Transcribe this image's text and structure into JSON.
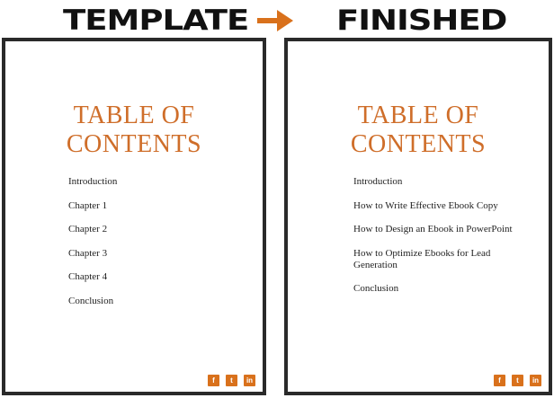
{
  "header": {
    "left_label": "TEMPLATE",
    "right_label": "FINISHED"
  },
  "arrow_color": "#d9711c",
  "accent_color": "#cf6e2a",
  "left_page": {
    "title_line1": "TABLE OF",
    "title_line2": "CONTENTS",
    "items": [
      "Introduction",
      "Chapter 1",
      "Chapter 2",
      "Chapter 3",
      "Chapter 4",
      "Conclusion"
    ],
    "social": [
      "f",
      "t",
      "in"
    ]
  },
  "right_page": {
    "title_line1": "TABLE OF",
    "title_line2": "CONTENTS",
    "items": [
      "Introduction",
      "How to Write Effective Ebook Copy",
      "How to Design an Ebook in PowerPoint",
      "How to Optimize Ebooks for Lead Generation",
      "Conclusion"
    ],
    "social": [
      "f",
      "t",
      "in"
    ]
  },
  "icons": [
    "facebook-icon",
    "twitter-icon",
    "linkedin-icon"
  ]
}
